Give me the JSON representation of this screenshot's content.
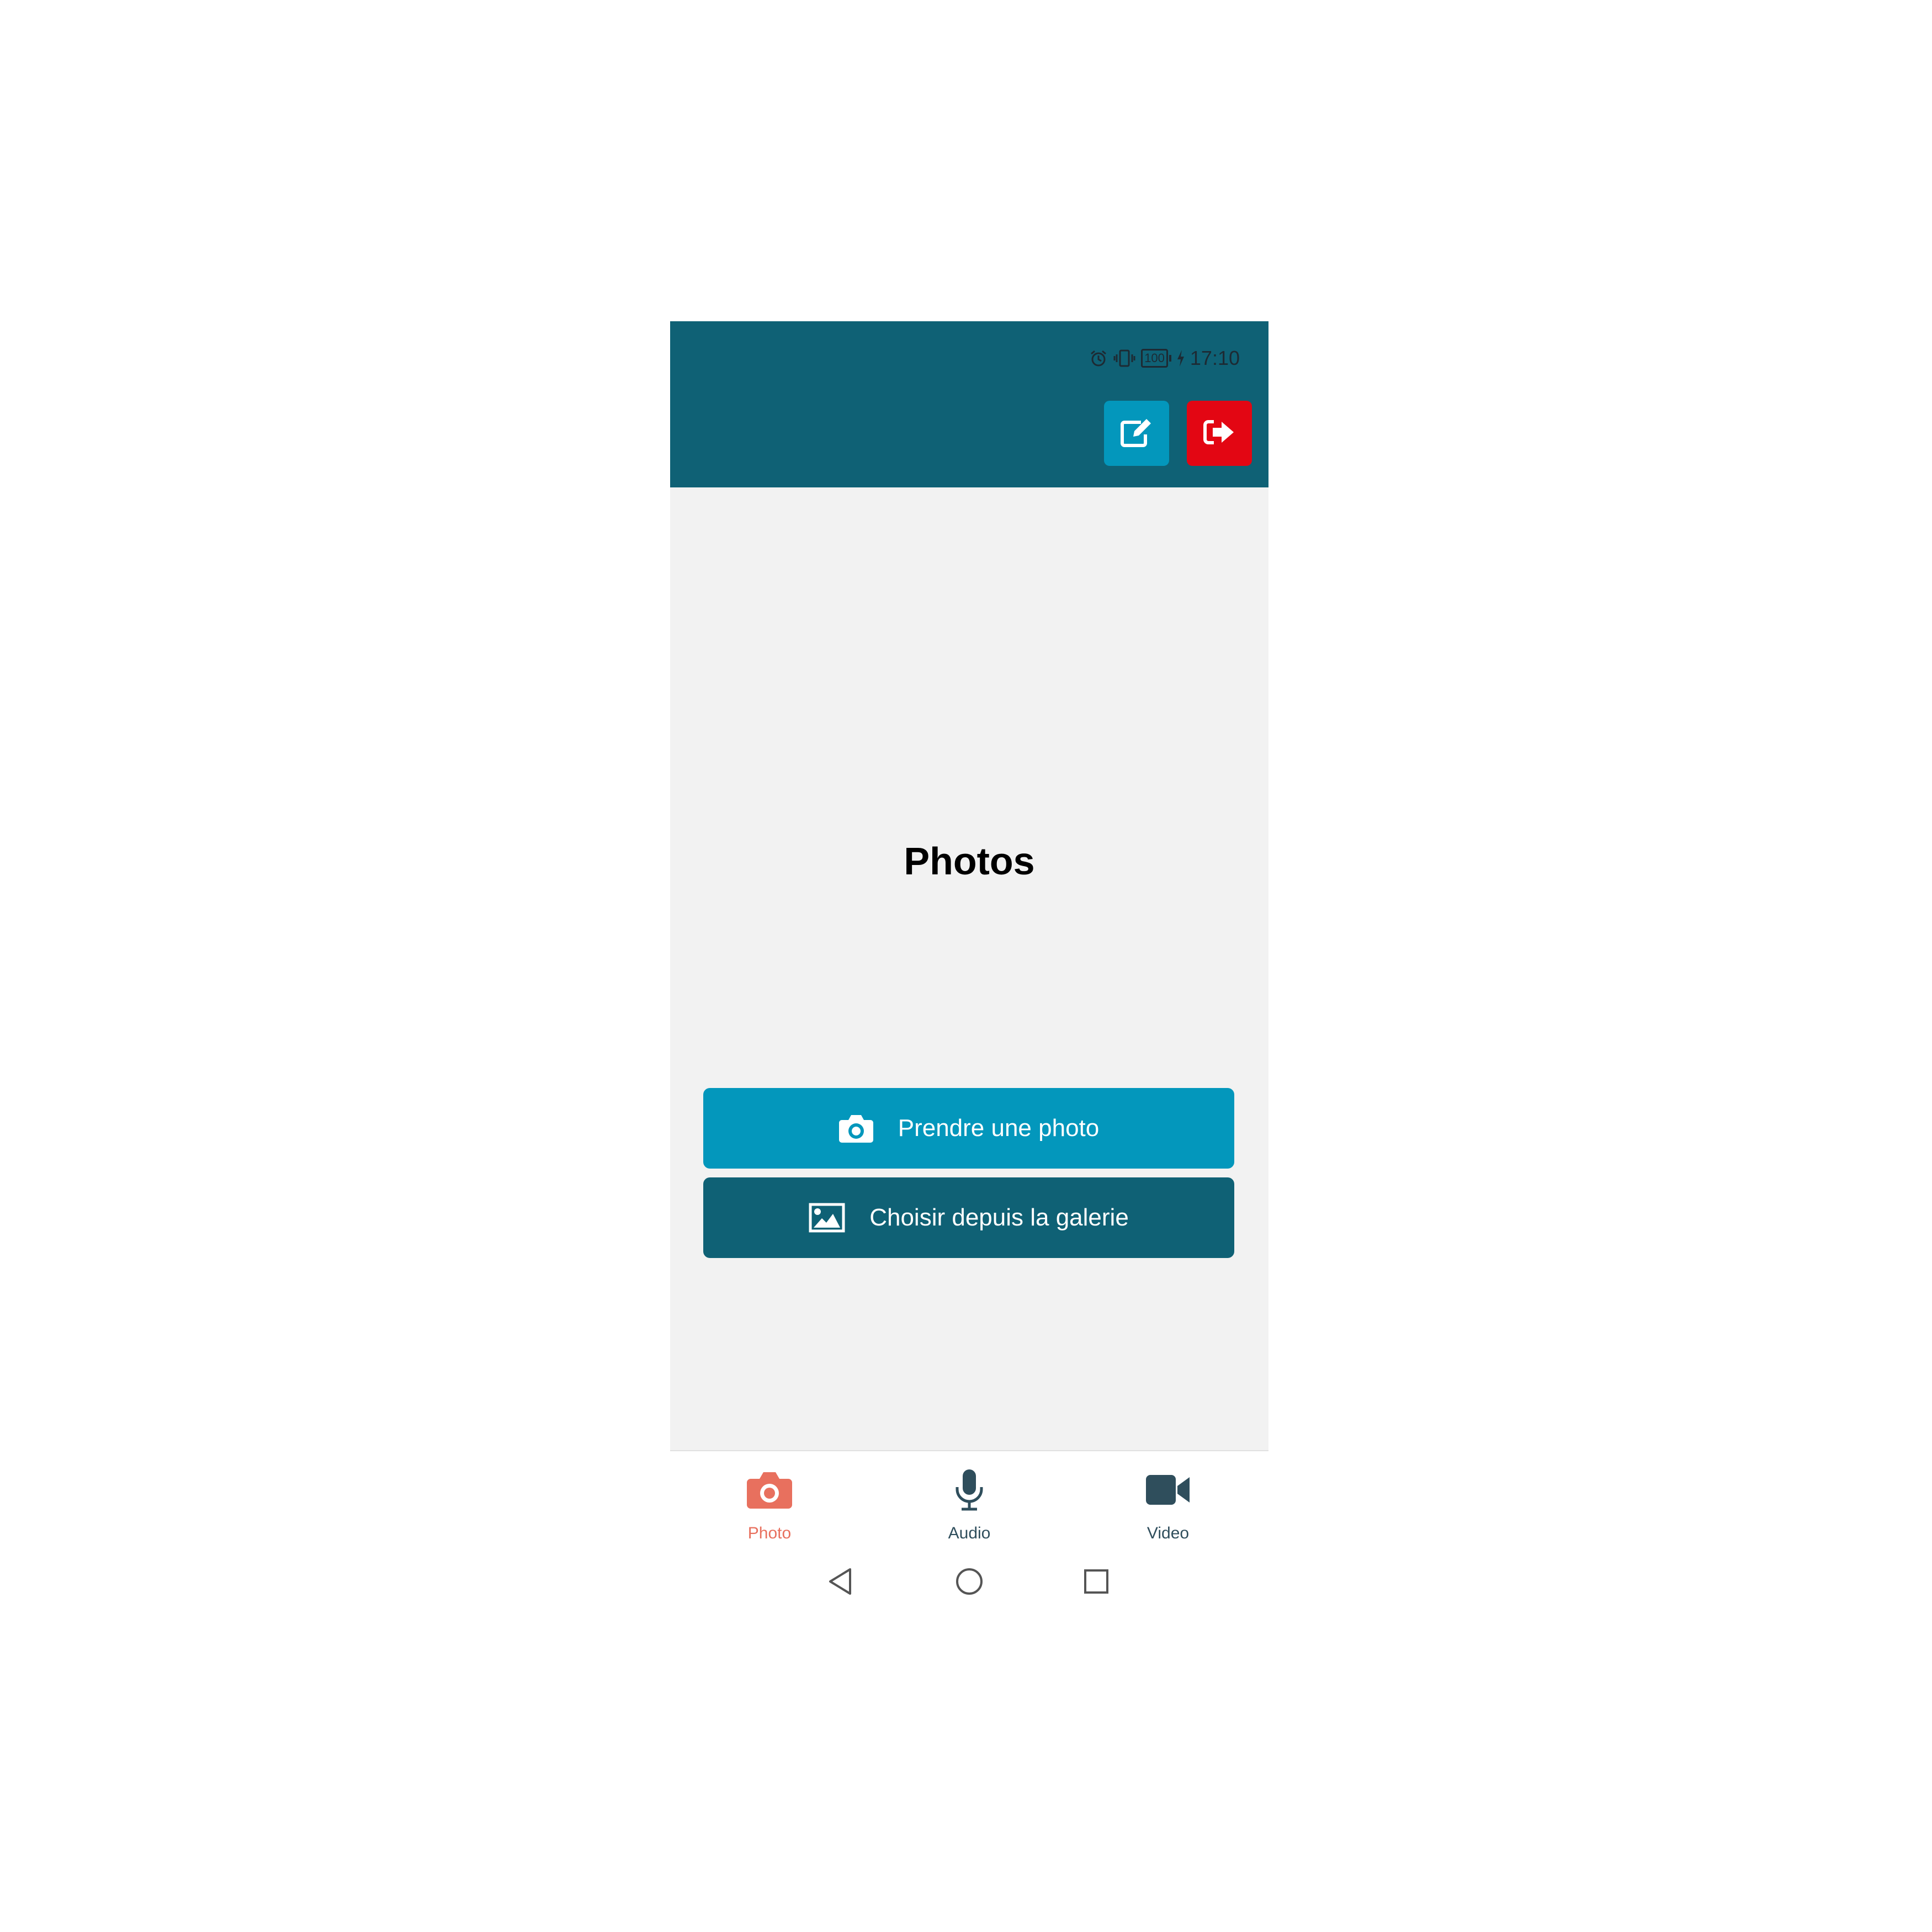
{
  "status_bar": {
    "battery_level": "100",
    "time": "17:10"
  },
  "header": {
    "edit_icon": "edit-icon",
    "logout_icon": "logout-icon"
  },
  "main": {
    "title": "Photos",
    "take_photo_label": "Prendre une photo",
    "gallery_label": "Choisir depuis la galerie"
  },
  "tabs": [
    {
      "label": "Photo",
      "icon": "camera-icon",
      "active": true
    },
    {
      "label": "Audio",
      "icon": "microphone-icon",
      "active": false
    },
    {
      "label": "Video",
      "icon": "video-camera-icon",
      "active": false
    }
  ],
  "colors": {
    "header": "#0f6175",
    "primary_button": "#0397bc",
    "secondary_button": "#0f6175",
    "logout_button": "#e30613",
    "active_tab": "#e8705e",
    "inactive_tab": "#2f4e5c",
    "content_background": "#f2f2f2"
  }
}
